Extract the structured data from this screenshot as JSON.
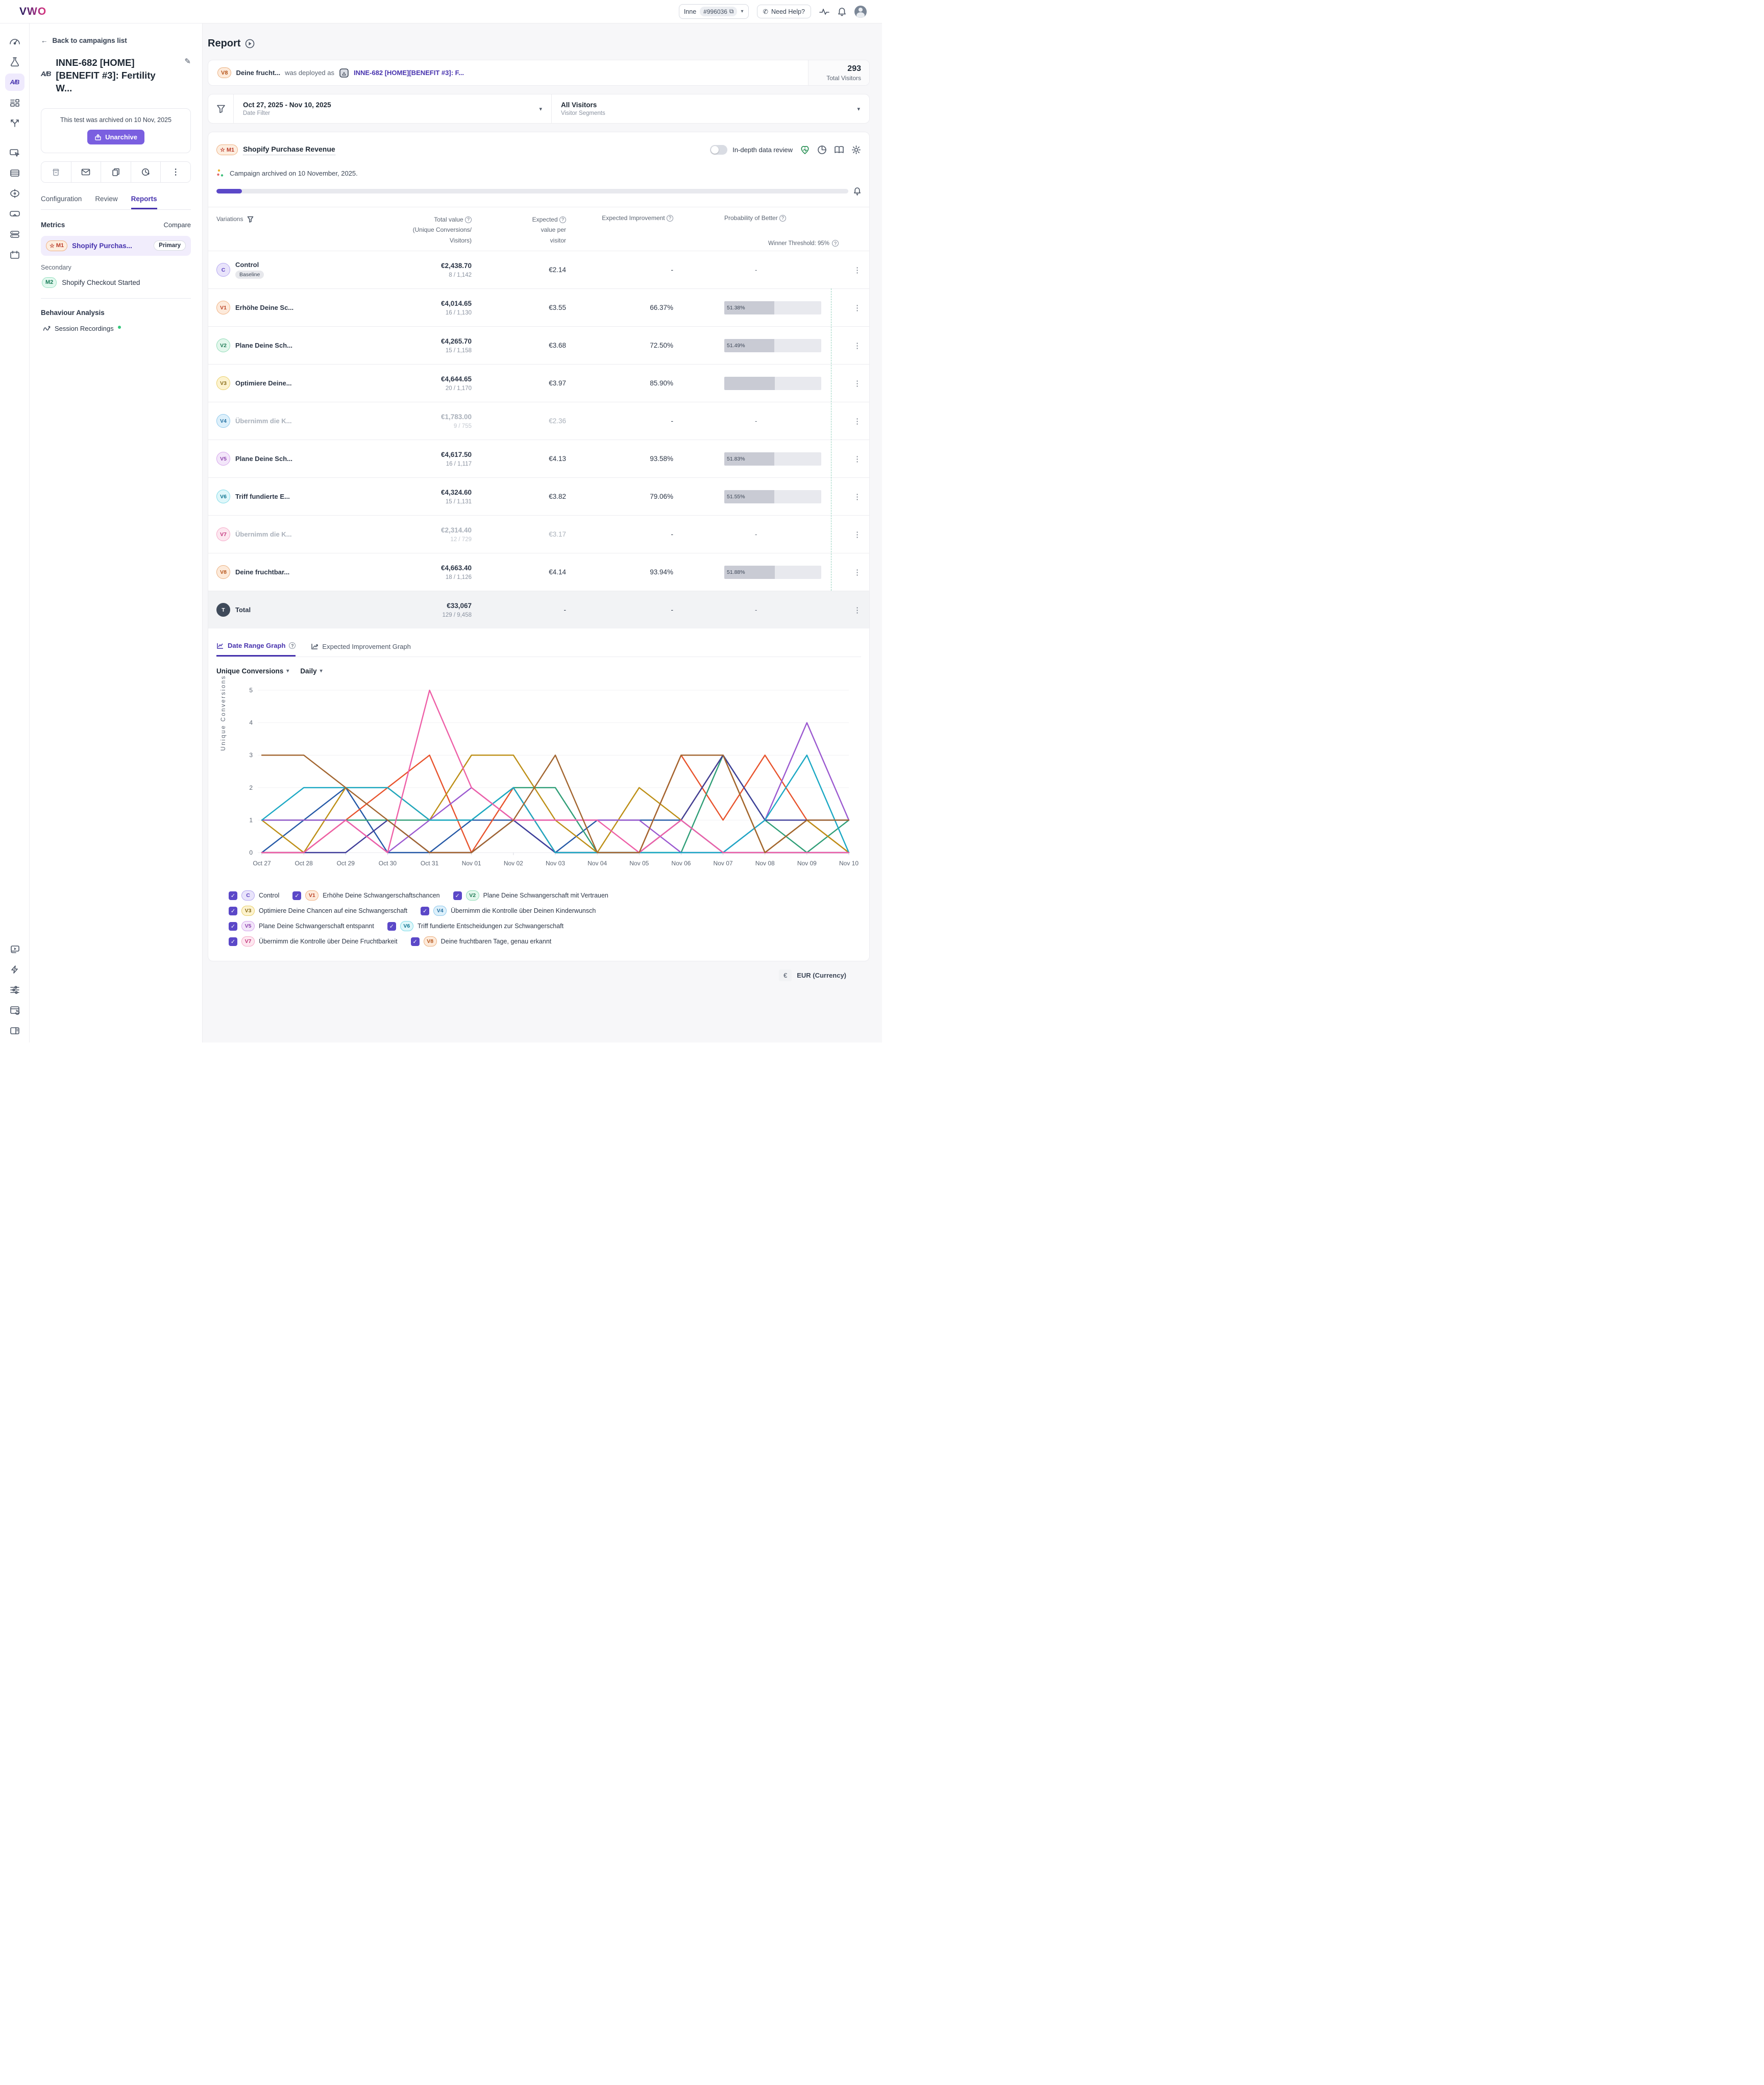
{
  "topbar": {
    "logo": "VWO",
    "account_name": "Inne",
    "account_id": "#996036",
    "need_help_label": "Need Help?"
  },
  "icons": [
    "gauge-icon",
    "flask-icon",
    "ab-test-icon",
    "layout-icon",
    "branch-icon",
    "personalize-icon",
    "server-icon",
    "target-icon",
    "goggles-icon",
    "database-icon",
    "calendar-icon",
    "video-icon",
    "bolt-icon",
    "sliders-icon",
    "window-history-icon",
    "panel-icon"
  ],
  "campaign_panel": {
    "back_label": "Back to campaigns list",
    "ab_glyph": "A/B",
    "title": "INNE-682 [HOME] [BENEFIT #3]: Fertility W...",
    "archived_note": "This test was archived on 10 Nov, 2025",
    "unarchive_label": "Unarchive",
    "tabs": {
      "configuration": "Configuration",
      "review": "Review",
      "reports": "Reports"
    },
    "metrics_title": "Metrics",
    "compare_label": "Compare",
    "m1_badge": "M1",
    "m1_name": "Shopify Purchas...",
    "m1_primary": "Primary",
    "secondary_label": "Secondary",
    "m2_badge": "M2",
    "m2_name": "Shopify Checkout Started",
    "behaviour_title": "Behaviour Analysis",
    "session_recordings": "Session Recordings"
  },
  "report": {
    "title": "Report",
    "banner": {
      "variation_badge": "V8",
      "variation_name": "Deine frucht...",
      "deployed_text": "was deployed as",
      "link_text": "INNE-682 [HOME][BENEFIT #3]: F...",
      "total_visitors_value": "293",
      "total_visitors_label": "Total Visitors"
    },
    "filters": {
      "date_value": "Oct 27, 2025 - Nov 10, 2025",
      "date_label": "Date Filter",
      "segment_value": "All Visitors",
      "segment_label": "Visitor Segments"
    },
    "metric": {
      "badge": "M1",
      "name": "Shopify Purchase Revenue",
      "toggle_label": "In-depth data review",
      "archived_note": "Campaign archived on 10 November, 2025.",
      "progress_pct": 4
    }
  },
  "table": {
    "headers": {
      "variations": "Variations",
      "total_value": "Total value",
      "total_value_sub1": "(Unique Conversions/",
      "total_value_sub2": "Visitors)",
      "expected1": "Expected",
      "expected2": "value per",
      "expected3": "visitor",
      "improvement": "Expected Improvement",
      "probability": "Probability of Better",
      "winner_threshold": "Winner Threshold: 95%"
    },
    "rows": [
      {
        "badge": "C",
        "cls": "c-c",
        "name": "Control",
        "tag": "Baseline",
        "total": "€2,438.70",
        "conv": "8 / 1,142",
        "expected": "€2.14",
        "improvement": "-",
        "bar": null,
        "prob": "-",
        "muted": false
      },
      {
        "badge": "V1",
        "cls": "c-v1",
        "name": "Erhöhe Deine Sc...",
        "tag": null,
        "total": "€4,014.65",
        "conv": "16 / 1,130",
        "expected": "€3.55",
        "improvement": "66.37%",
        "bar": {
          "label": "51.38%",
          "fill": 51.4
        },
        "prob": null,
        "muted": false
      },
      {
        "badge": "V2",
        "cls": "c-v2",
        "name": "Plane Deine Sch...",
        "tag": null,
        "total": "€4,265.70",
        "conv": "15 / 1,158",
        "expected": "€3.68",
        "improvement": "72.50%",
        "bar": {
          "label": "51.49%",
          "fill": 51.5
        },
        "prob": null,
        "muted": false
      },
      {
        "badge": "V3",
        "cls": "c-v3",
        "name": "Optimiere Deine...",
        "tag": null,
        "total": "€4,644.65",
        "conv": "20 / 1,170",
        "expected": "€3.97",
        "improvement": "85.90%",
        "bar": {
          "label": "",
          "fill": 52.0
        },
        "prob": null,
        "muted": false
      },
      {
        "badge": "V4",
        "cls": "c-v4",
        "name": "Übernimm die K...",
        "tag": null,
        "total": "€1,783.00",
        "conv": "9 / 755",
        "expected": "€2.36",
        "improvement": "-",
        "bar": null,
        "prob": "-",
        "muted": true
      },
      {
        "badge": "V5",
        "cls": "c-v5",
        "name": "Plane Deine Sch...",
        "tag": null,
        "total": "€4,617.50",
        "conv": "16 / 1,117",
        "expected": "€4.13",
        "improvement": "93.58%",
        "bar": {
          "label": "51.83%",
          "fill": 51.8
        },
        "prob": null,
        "muted": false
      },
      {
        "badge": "V6",
        "cls": "c-v6",
        "name": "Triff fundierte E...",
        "tag": null,
        "total": "€4,324.60",
        "conv": "15 / 1,131",
        "expected": "€3.82",
        "improvement": "79.06%",
        "bar": {
          "label": "51.55%",
          "fill": 51.6
        },
        "prob": null,
        "muted": false
      },
      {
        "badge": "V7",
        "cls": "c-v7",
        "name": "Übernimm die K...",
        "tag": null,
        "total": "€2,314.40",
        "conv": "12 / 729",
        "expected": "€3.17",
        "improvement": "-",
        "bar": null,
        "prob": "-",
        "muted": true
      },
      {
        "badge": "V8",
        "cls": "c-v8",
        "name": "Deine fruchtbar...",
        "tag": null,
        "total": "€4,663.40",
        "conv": "18 / 1,126",
        "expected": "€4.14",
        "improvement": "93.94%",
        "bar": {
          "label": "51.88%",
          "fill": 51.9
        },
        "prob": null,
        "muted": false
      },
      {
        "badge": "T",
        "cls": "c-t",
        "name": "Total",
        "tag": null,
        "total": "€33,067",
        "conv": "129 / 9,458",
        "expected": "-",
        "improvement": "-",
        "bar": null,
        "prob": "-",
        "muted": false,
        "is_total": true
      }
    ]
  },
  "graph_section": {
    "tab_date_range": "Date Range Graph",
    "tab_expected": "Expected Improvement Graph",
    "metric_dropdown": "Unique Conversions",
    "period_dropdown": "Daily",
    "ylabel": "Unique Conversions"
  },
  "chart_data": {
    "type": "line",
    "title": "",
    "xlabel": "",
    "ylabel": "Unique Conversions",
    "ylim": [
      0,
      5
    ],
    "yticks": [
      0,
      1,
      2,
      3,
      4,
      5
    ],
    "grid": true,
    "legend_position": "bottom",
    "x": [
      "Oct 27",
      "Oct 28",
      "Oct 29",
      "Oct 30",
      "Oct 31",
      "Nov 01",
      "Nov 02",
      "Nov 03",
      "Nov 04",
      "Nov 05",
      "Nov 06",
      "Nov 07",
      "Nov 08",
      "Nov 09",
      "Nov 10"
    ],
    "series": [
      {
        "name": "Control",
        "color": "#2458a6",
        "values": [
          0,
          1,
          2,
          0,
          0,
          1,
          1,
          0,
          1,
          1,
          1,
          0,
          0,
          0,
          0
        ]
      },
      {
        "name": "Erhöhe Deine Schwangerschaftschancen",
        "color": "#e8532c",
        "values": [
          0,
          0,
          1,
          2,
          3,
          0,
          2,
          0,
          0,
          0,
          3,
          1,
          3,
          1,
          0
        ]
      },
      {
        "name": "Plane Deine Schwangerschaft mit Vertrauen",
        "color": "#2f9e77",
        "values": [
          1,
          1,
          1,
          1,
          1,
          1,
          2,
          2,
          0,
          0,
          0,
          3,
          1,
          0,
          1
        ]
      },
      {
        "name": "Optimiere Deine Chancen auf eine Schwangerschaft",
        "color": "#bd8f16",
        "values": [
          1,
          0,
          2,
          2,
          1,
          3,
          3,
          1,
          0,
          2,
          1,
          3,
          0,
          1,
          0
        ]
      },
      {
        "name": "Übernimm die Kontrolle über Deinen Kinderwunsch",
        "color": "#3f3d99",
        "values": [
          0,
          0,
          0,
          1,
          0,
          0,
          1,
          0,
          0,
          0,
          1,
          3,
          1,
          1,
          1
        ]
      },
      {
        "name": "Plane Deine Schwangerschaft entspannt",
        "color": "#9b59d0",
        "values": [
          1,
          1,
          1,
          0,
          1,
          2,
          1,
          1,
          1,
          1,
          0,
          0,
          1,
          4,
          1
        ]
      },
      {
        "name": "Triff fundierte Entscheidungen zur Schwangerschaft",
        "color": "#1ba8c4",
        "values": [
          1,
          2,
          2,
          2,
          1,
          1,
          2,
          0,
          0,
          0,
          0,
          0,
          1,
          3,
          0
        ]
      },
      {
        "name": "Übernimm die Kontrolle über Deine Fruchtbarkeit",
        "color": "#ee5fa7",
        "values": [
          0,
          0,
          1,
          0,
          5,
          2,
          1,
          1,
          1,
          0,
          1,
          0,
          0,
          0,
          0
        ]
      },
      {
        "name": "Deine fruchtbaren Tage, genau erkannt",
        "color": "#a2652f",
        "values": [
          3,
          3,
          2,
          1,
          0,
          0,
          1,
          3,
          0,
          0,
          3,
          3,
          0,
          1,
          1
        ]
      }
    ]
  },
  "legend": {
    "rows": [
      [
        {
          "badge": "C",
          "cls": "c-c",
          "label": "Control"
        },
        {
          "badge": "V1",
          "cls": "c-v1",
          "label": "Erhöhe Deine Schwangerschaftschancen"
        },
        {
          "badge": "V2",
          "cls": "c-v2",
          "label": "Plane Deine Schwangerschaft mit Vertrauen"
        }
      ],
      [
        {
          "badge": "V3",
          "cls": "c-v3",
          "label": "Optimiere Deine Chancen auf eine Schwangerschaft"
        },
        {
          "badge": "V4",
          "cls": "c-v4",
          "label": "Übernimm die Kontrolle über Deinen Kinderwunsch"
        }
      ],
      [
        {
          "badge": "V5",
          "cls": "c-v5",
          "label": "Plane Deine Schwangerschaft entspannt"
        },
        {
          "badge": "V6",
          "cls": "c-v6",
          "label": "Triff fundierte Entscheidungen zur Schwangerschaft"
        }
      ],
      [
        {
          "badge": "V7",
          "cls": "c-v7",
          "label": "Übernimm die Kontrolle über Deine Fruchtbarkeit"
        },
        {
          "badge": "V8",
          "cls": "c-v8",
          "label": "Deine fruchtbaren Tage, genau erkannt"
        }
      ]
    ]
  },
  "footer": {
    "currency_symbol": "€",
    "currency_label": "EUR (Currency)"
  }
}
